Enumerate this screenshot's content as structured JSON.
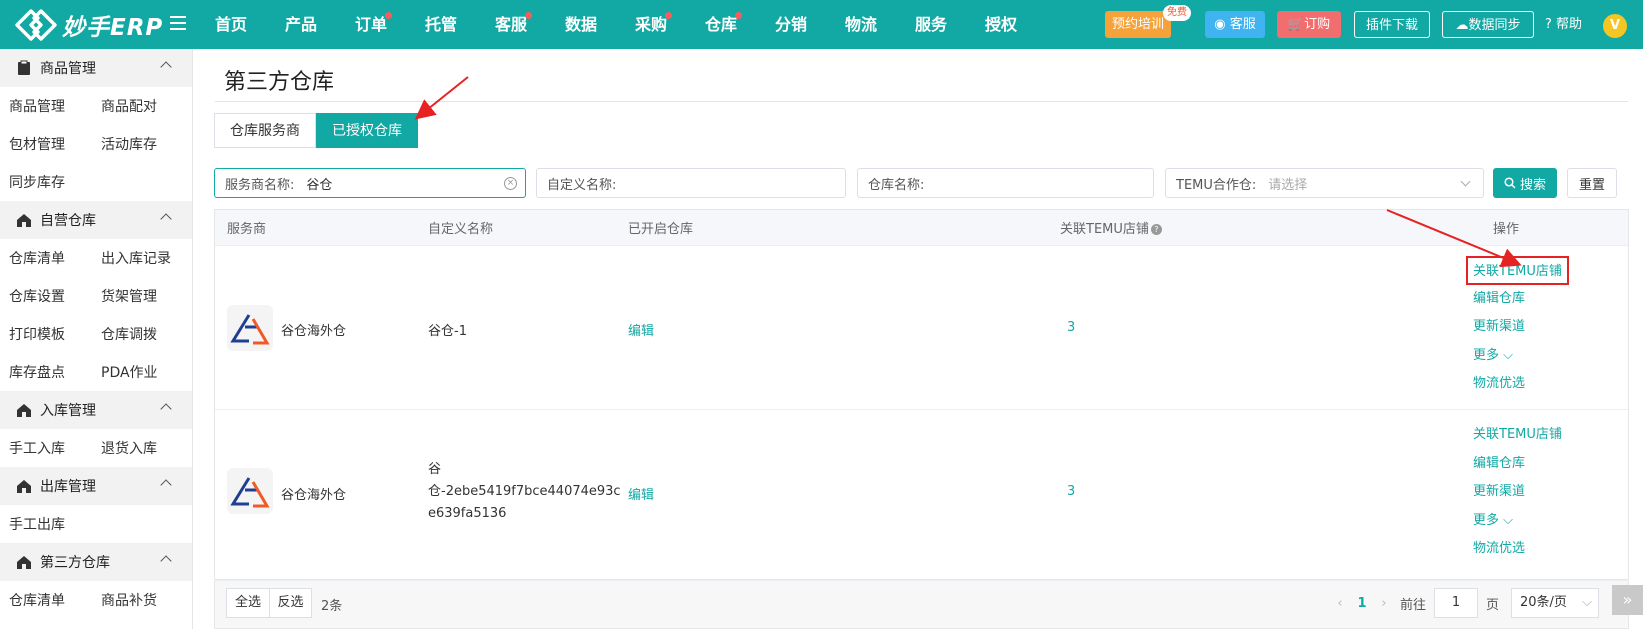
{
  "app": {
    "logo_text": "妙手ERP"
  },
  "nav": [
    "首页",
    "产品",
    "订单",
    "托管",
    "客服",
    "数据",
    "采购",
    "仓库",
    "分销",
    "物流",
    "服务",
    "授权"
  ],
  "nav_dots": [
    false,
    false,
    true,
    false,
    true,
    false,
    true,
    true,
    false,
    false,
    false,
    false
  ],
  "topbar": {
    "training": "预约培训",
    "free_badge": "免费",
    "service": "客服",
    "order": "订购",
    "plugin": "插件下载",
    "sync": "数据同步",
    "help": "帮助",
    "avatar_letter": "V"
  },
  "sidebar": {
    "sections": [
      {
        "title": "商品管理",
        "items": [
          "商品管理",
          "商品配对",
          "包材管理",
          "活动库存",
          "同步库存"
        ]
      },
      {
        "title": "自营仓库",
        "items": [
          "仓库清单",
          "出入库记录",
          "仓库设置",
          "货架管理",
          "打印模板",
          "仓库调拨",
          "库存盘点",
          "PDA作业"
        ]
      },
      {
        "title": "入库管理",
        "items": [
          "手工入库",
          "退货入库"
        ]
      },
      {
        "title": "出库管理",
        "items": [
          "手工出库"
        ]
      },
      {
        "title": "第三方仓库",
        "items": [
          "仓库清单",
          "商品补货"
        ]
      }
    ]
  },
  "page": {
    "title": "第三方仓库",
    "tabs": [
      "仓库服务商",
      "已授权仓库"
    ]
  },
  "filters": {
    "provider_label": "服务商名称:",
    "provider_value": "谷仓",
    "custom_label": "自定义名称:",
    "warehouse_label": "仓库名称:",
    "temu_label": "TEMU合作仓:",
    "temu_placeholder": "请选择",
    "search": "搜索",
    "reset": "重置"
  },
  "table": {
    "columns": [
      "服务商",
      "自定义名称",
      "已开启仓库",
      "关联TEMU店铺",
      "操作"
    ],
    "rows": [
      {
        "provider": "谷仓海外仓",
        "custom_name_lines": [
          "谷仓-1"
        ],
        "warehouses": "编辑",
        "temu_shops": "3"
      },
      {
        "provider": "谷仓海外仓",
        "custom_name_lines": [
          "谷",
          "仓-2ebe5419f7bce44074e93c",
          "e639fa5136"
        ],
        "warehouses": "编辑",
        "temu_shops": "3"
      }
    ],
    "ops": [
      "关联TEMU店铺",
      "编辑仓库",
      "更新渠道",
      "更多",
      "物流优选"
    ]
  },
  "footer": {
    "select_all": "全选",
    "invert": "反选",
    "count": "2条",
    "current_page": "1",
    "goto": "前往",
    "page_input": "1",
    "page_unit": "页",
    "page_size": "20条/页"
  },
  "colors": {
    "brand": "#12a9a4",
    "highlight": "#e52323",
    "accent_dot": "#ff5a5a"
  }
}
